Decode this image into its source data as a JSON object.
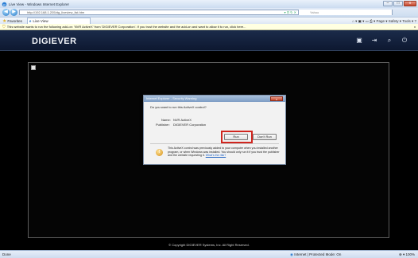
{
  "window": {
    "title": "Live View - Windows Internet Explorer",
    "controls": [
      "–",
      "□",
      "x"
    ]
  },
  "address_bar": {
    "url": "http://192.168.1.205/dg_liveview_list.htm",
    "search_placeholder": "Yahoo",
    "back_glyph": "◀",
    "forward_glyph": "▶",
    "icons_text": "▾ ⊡ ↻ ✕"
  },
  "favorites_bar": {
    "favorites_label": "Favorites",
    "tab_label": "Live View",
    "commands": "⌂ ▾  ▣ ▾  ▭  ⎙ ▾  Page ▾  Safety ▾  Tools ▾  ?"
  },
  "info_bar": {
    "message": "This website wants to run the following add-on: 'NVR ActiveX' from 'DIGIEVER Corporation'. If you trust the website and the add-on and want to allow it to run, click here...",
    "close": "x"
  },
  "app_header": {
    "logo": "DIGIEVER",
    "icons": [
      "monitor-icon",
      "exit-icon",
      "search-icon",
      "logout-icon"
    ]
  },
  "viewer": {
    "copyright": "© Copyright DIGIEVER Systems, Inc. All Right Reserved."
  },
  "dialog": {
    "title": "Internet Explorer - Security Warning",
    "close": "x",
    "question": "Do you want to run this ActiveX control?",
    "name_label": "Name:",
    "name_value": "NVR ActiveX",
    "publisher_label": "Publisher:",
    "publisher_value": "DIGIEVER Corporation",
    "run_label": "Run",
    "dont_run_label": "Don't Run",
    "warning_text": "This ActiveX control was previously added to your computer when you installed another program, or when Windows was installed. You should only run it if you trust the publisher and the website requesting it.",
    "warning_link": "What's the risk?"
  },
  "status_bar": {
    "left": "Done",
    "zone": "Internet | Protected Mode: On",
    "zoom": "⊕ ▾  100%"
  }
}
